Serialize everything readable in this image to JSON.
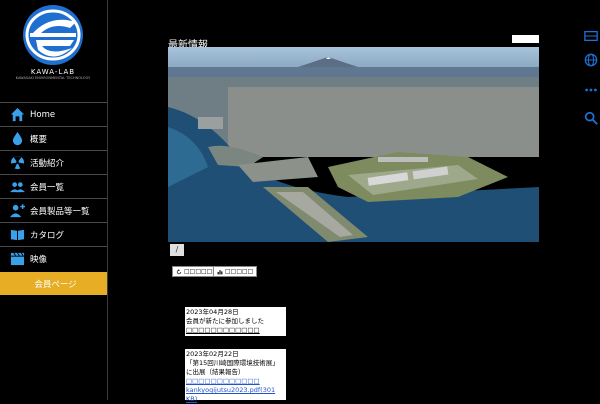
{
  "logo": {
    "brand": "KAWA-LAB",
    "subtitle": "KAWASAKI ENVIRONMENTAL TECHNOLOGY"
  },
  "nav": {
    "items": [
      {
        "label": "Home",
        "icon": "home-icon"
      },
      {
        "label": "概要",
        "icon": "water-drop-icon"
      },
      {
        "label": "活動紹介",
        "icon": "radiation-icon"
      },
      {
        "label": "会員一覧",
        "icon": "users-icon"
      },
      {
        "label": "会員製品等一覧",
        "icon": "user-add-icon"
      },
      {
        "label": "カタログ",
        "icon": "book-icon"
      },
      {
        "label": "映像",
        "icon": "clapperboard-icon"
      }
    ],
    "member_label": "会員ページ"
  },
  "right_icons": [
    "grid-icon",
    "globe-icon",
    "more-icon",
    "search-icon"
  ],
  "main": {
    "title": "最新情報",
    "pager_label": "/",
    "button1": "□□□□□□",
    "button2": "□□□□□"
  },
  "news": [
    {
      "date": "2023年04月28日",
      "text": "会員が新たに参加しました",
      "sub": "□□□□□□□□□□□□"
    },
    {
      "date": "2023年02月22日",
      "text": "「第15回川崎国際環境技術展」に出展（結果報告）",
      "sub": "□□□□□□□□□□□□",
      "file": "kankyogijutsu2023.pdf(301 KB)"
    }
  ],
  "colors": {
    "accent": "#e6ad25",
    "background": "#000000",
    "logo_blue": "#1e6fd0"
  }
}
